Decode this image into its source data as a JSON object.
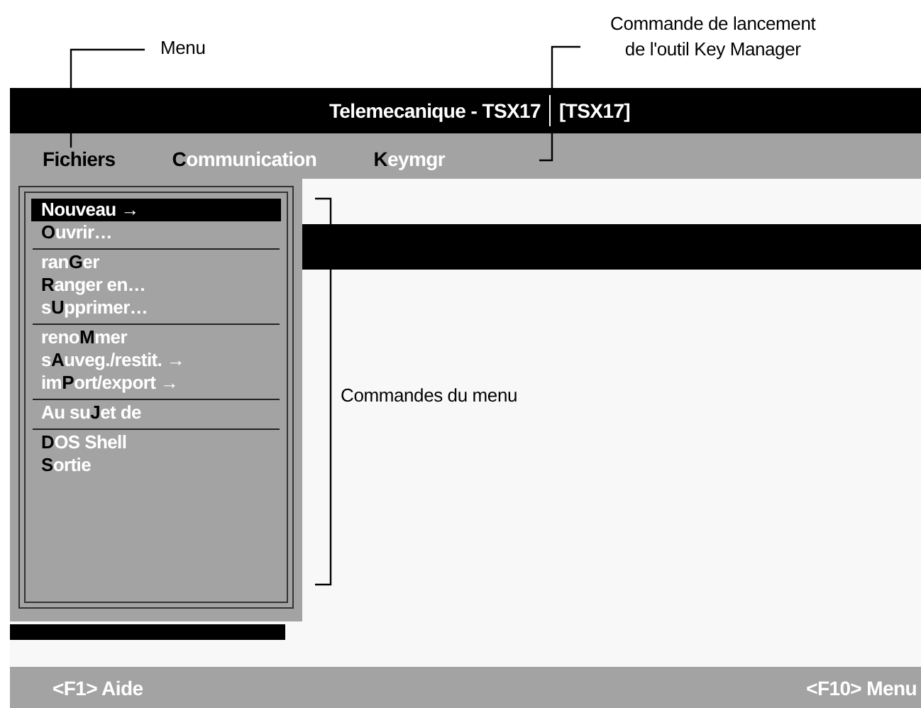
{
  "annotations": [
    {
      "kind": "menu",
      "text": "Menu"
    },
    {
      "kind": "tool",
      "text": "Commande de lancement\nde l'outil Key Manager"
    },
    {
      "kind": "commands",
      "text": "Commandes du menu"
    }
  ],
  "window": {
    "title": "Telemecanique - TSX17",
    "project": "[TSX17]"
  },
  "menubar": [
    {
      "label": "**Fichiers**"
    },
    {
      "label": "**C**ommunication"
    },
    {
      "label": "**K**eymgr"
    }
  ],
  "menu_groups": [
    {
      "items": [
        {
          "label": "Nouveau →",
          "selected": true
        },
        {
          "label": "**O**uvrir…",
          "selected": false
        }
      ]
    },
    {
      "items": [
        {
          "label": "ran**G**er",
          "selected": false
        },
        {
          "label": "**R**anger en…",
          "selected": false
        },
        {
          "label": "s**U**pprimer…",
          "selected": false
        }
      ]
    },
    {
      "items": [
        {
          "label": "reno**M**mer",
          "selected": false
        },
        {
          "label": "s**A**uveg./restit. →",
          "selected": false
        },
        {
          "label": "im**P**ort/export →",
          "selected": false
        }
      ]
    },
    {
      "items": [
        {
          "label": "Au su**J**et de",
          "selected": false
        }
      ]
    },
    {
      "items": [
        {
          "label": "**D**OS Shell",
          "selected": false
        },
        {
          "label": "**S**ortie",
          "selected": false
        }
      ]
    }
  ],
  "status_bar": {
    "left": "<F1> Aide",
    "right": "<F10> Menu"
  }
}
